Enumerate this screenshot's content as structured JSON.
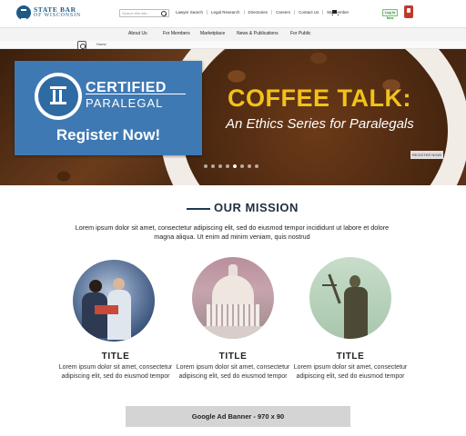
{
  "header": {
    "logo_line1": "STATE BAR",
    "logo_line2": "OF WISCONSIN",
    "search_placeholder": "Search this site...",
    "utility_links": [
      "Lawyer Search",
      "Legal Research",
      "Directories",
      "Careers",
      "Contact Us",
      "My Member"
    ],
    "login_label": "Log In Now"
  },
  "nav": {
    "items": [
      "About Us",
      "For Members",
      "Marketplace",
      "News & Publications",
      "For Public"
    ]
  },
  "breadcrumb": {
    "current": "Home"
  },
  "hero": {
    "cert_line1": "CERTIFIED",
    "cert_line2": "PARALEGAL",
    "cert_cta": "Register Now!",
    "headline": "COFFEE TALK:",
    "subheadline": "An Ethics Series for Paralegals",
    "button_label": "REGISTER NOW!",
    "slide_count": 8,
    "active_slide": 4
  },
  "mission": {
    "heading": "OUR MISSION",
    "body": "Lorem ipsum dolor sit amet, consectetur adipiscing elit, sed do eiusmod tempor incididunt ut labore et dolore magna aliqua. Ut enim ad minim veniam, quis nostrud"
  },
  "cards": [
    {
      "title": "TITLE",
      "body": "Lorem ipsum dolor sit amet, consectetur adipiscing elit, sed do eiusmod tempor"
    },
    {
      "title": "TITLE",
      "body": "Lorem ipsum dolor sit amet, consectetur adipiscing elit, sed do eiusmod tempor"
    },
    {
      "title": "TITLE",
      "body": "Lorem ipsum dolor sit amet, consectetur adipiscing elit, sed do eiusmod tempor"
    }
  ],
  "ad": {
    "label": "Google Ad Banner - 970 x 90"
  },
  "colors": {
    "brand_blue": "#1f5a86",
    "cert_panel": "#3f79b4",
    "headline_yellow": "#f2c21b",
    "ad_gray": "#d4d4d4"
  }
}
